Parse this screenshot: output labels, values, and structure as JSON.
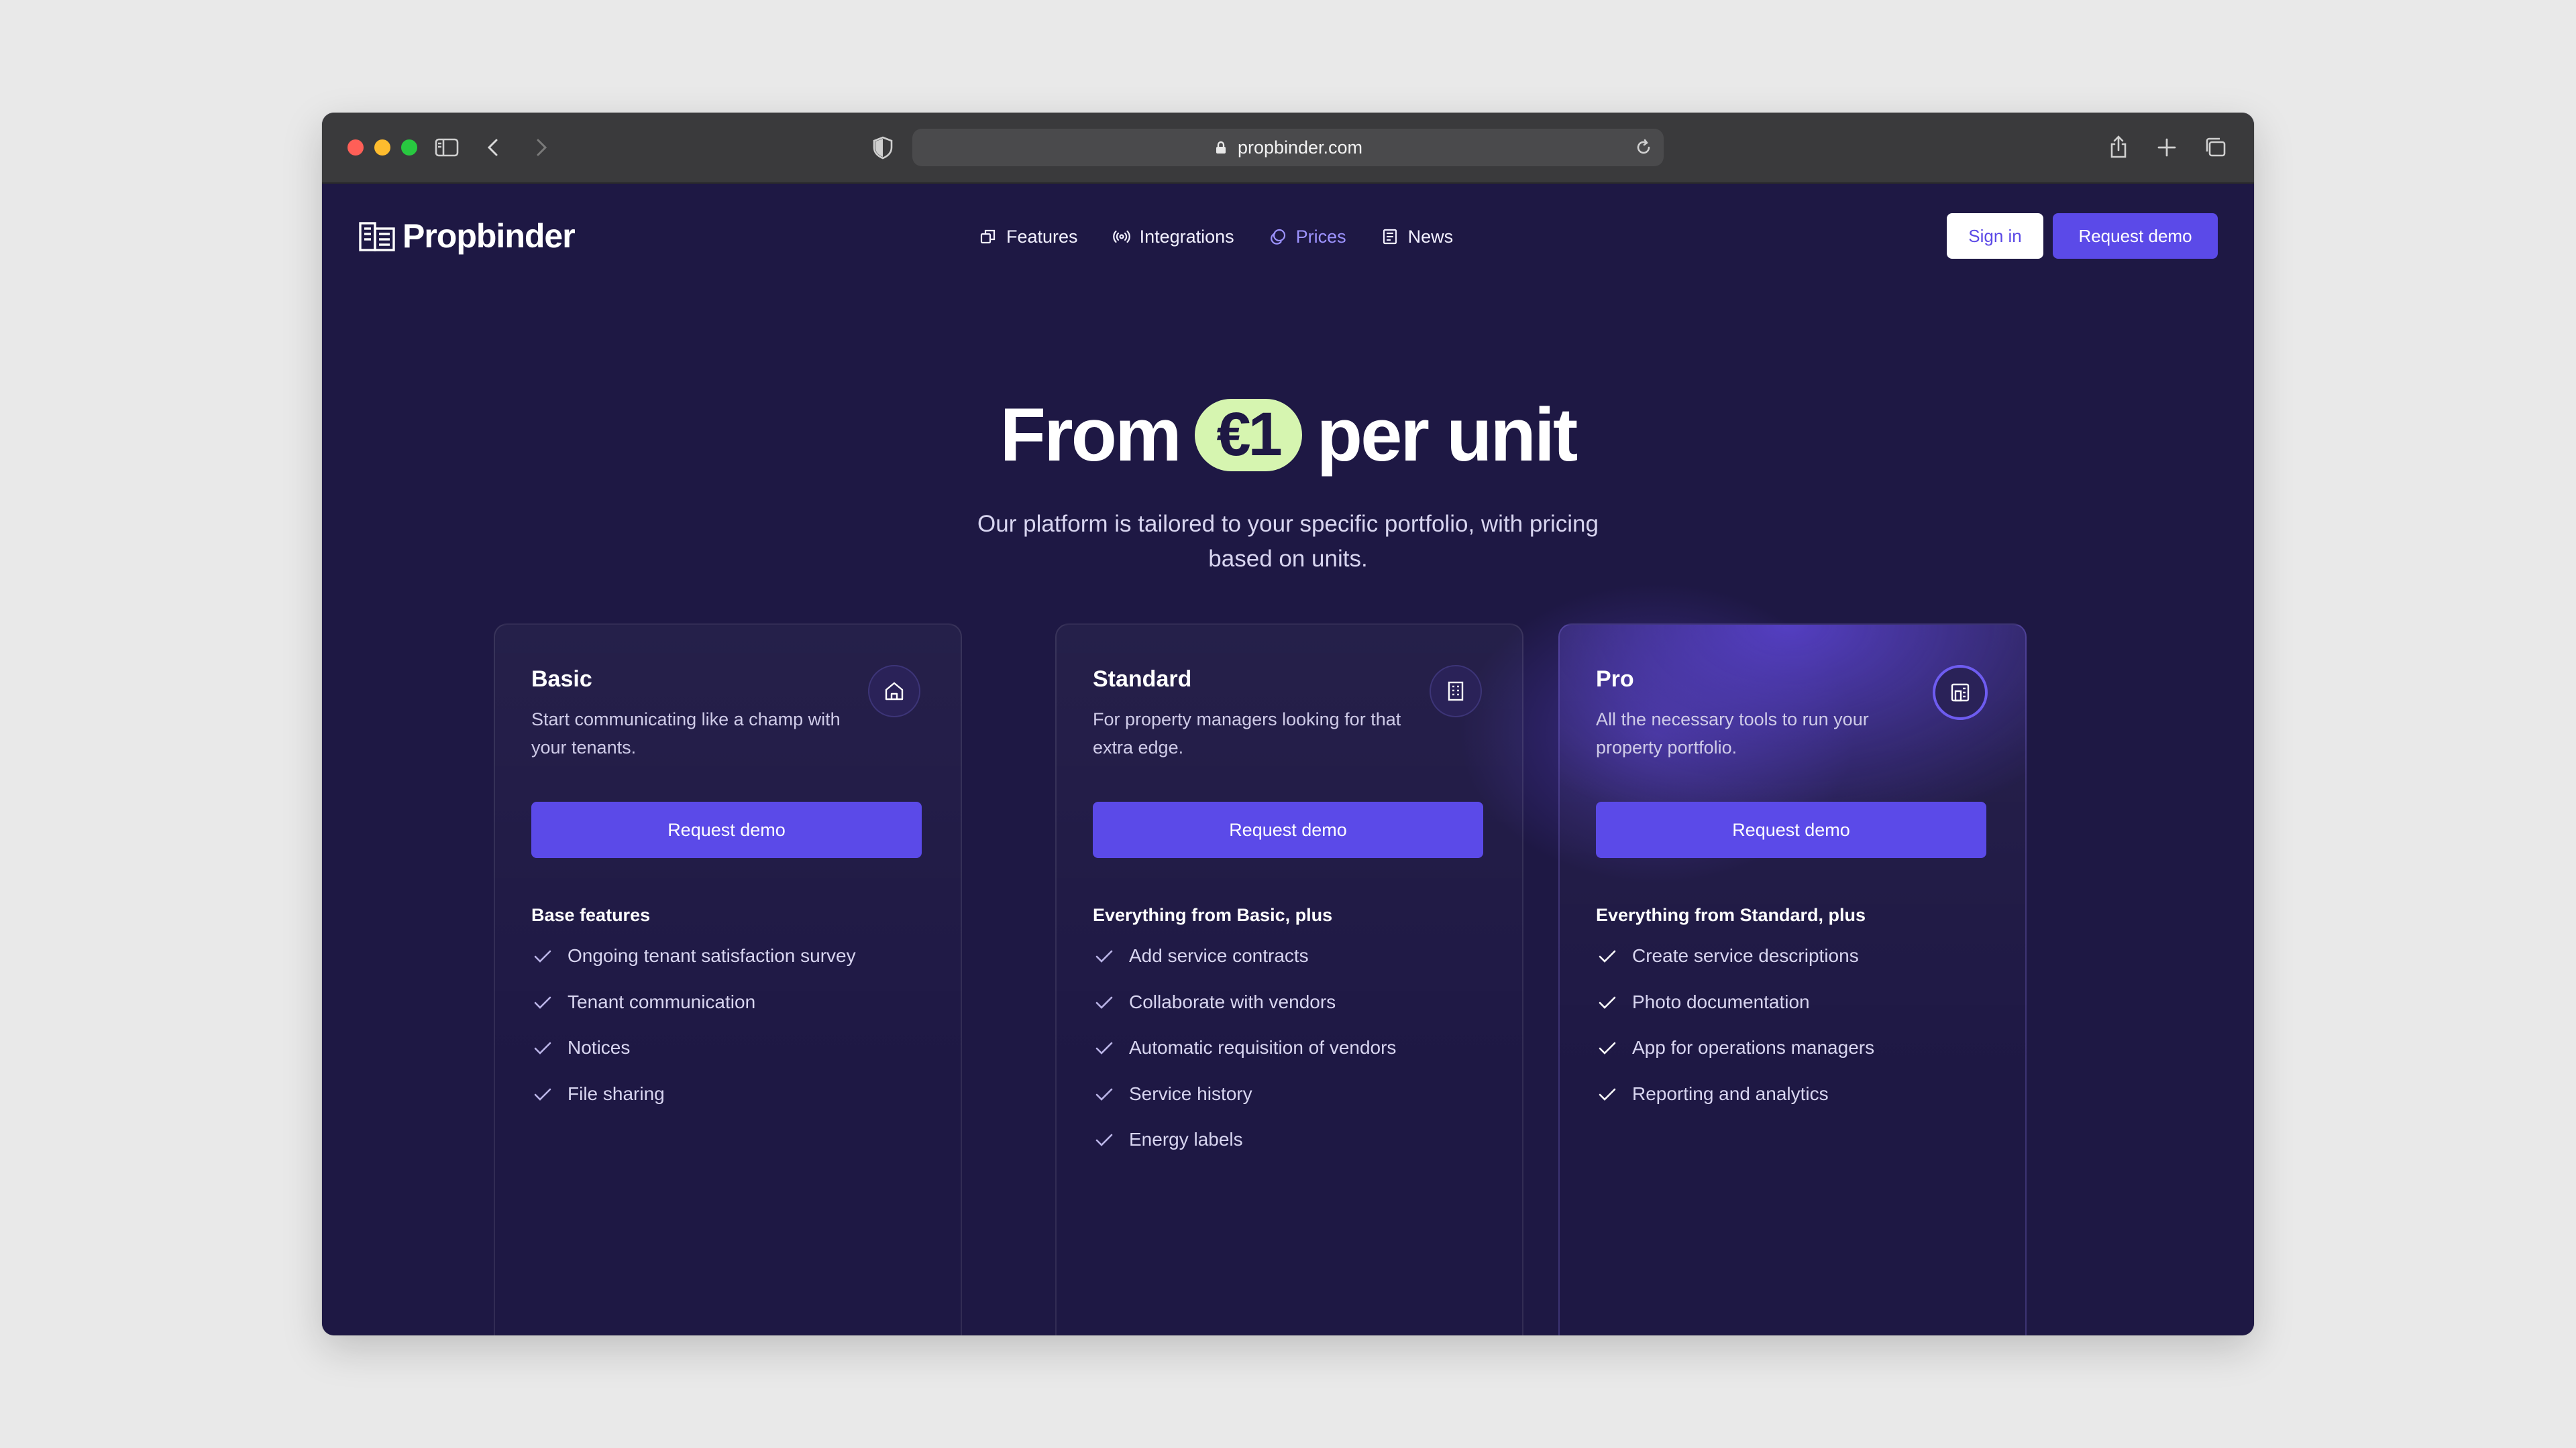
{
  "browser": {
    "url": "propbinder.com"
  },
  "site": {
    "brand": "Propbinder",
    "nav": [
      {
        "label": "Features",
        "icon": "layers-icon"
      },
      {
        "label": "Integrations",
        "icon": "broadcast-icon"
      },
      {
        "label": "Prices",
        "icon": "coins-icon",
        "active": true
      },
      {
        "label": "News",
        "icon": "newspaper-icon"
      }
    ],
    "sign_in": "Sign in",
    "request_demo": "Request demo"
  },
  "hero": {
    "title_before": "From",
    "price": "€1",
    "title_after": "per unit",
    "subtitle": "Our platform is tailored to your specific portfolio, with pricing based on units."
  },
  "plans": [
    {
      "name": "Basic",
      "icon": "home-icon",
      "description": "Start communicating like a champ with your tenants.",
      "cta": "Request demo",
      "features_heading": "Base features",
      "features": [
        "Ongoing tenant satisfaction survey",
        "Tenant communication",
        "Notices",
        "File sharing"
      ]
    },
    {
      "name": "Standard",
      "icon": "building-icon",
      "description": "For property managers looking for that extra edge.",
      "cta": "Request demo",
      "features_heading": "Everything from Basic, plus",
      "features": [
        "Add service contracts",
        "Collaborate with vendors",
        "Automatic requisition of vendors",
        "Service history",
        "Energy labels"
      ]
    },
    {
      "name": "Pro",
      "icon": "buildings-icon",
      "description": "All the necessary tools to run your property portfolio.",
      "cta": "Request demo",
      "features_heading": "Everything from Standard, plus",
      "features": [
        "Create service descriptions",
        "Photo documentation",
        "App for operations managers",
        "Reporting and analytics"
      ]
    }
  ],
  "colors": {
    "background": "#1e1844",
    "accent": "#5b4ae8",
    "price_pill": "#d6f5b0",
    "active_nav": "#9d93ff"
  }
}
